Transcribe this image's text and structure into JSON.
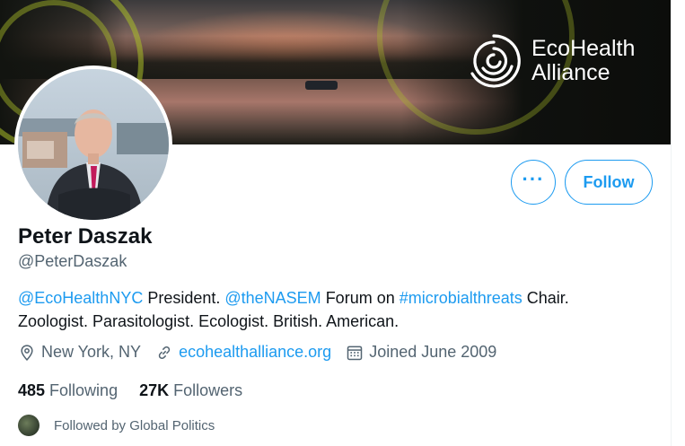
{
  "banner": {
    "brand_line1": "EcoHealth",
    "brand_line2": "Alliance",
    "logo_icon": "ecohealth-swirl-icon"
  },
  "profile": {
    "name": "Peter Daszak",
    "handle": "@PeterDaszak",
    "bio": {
      "mention1": "@EcoHealthNYC",
      "text1": " President. ",
      "mention2": "@theNASEM",
      "text2": " Forum on ",
      "hashtag": "#microbialthreats",
      "text3": " Chair.",
      "line2": "Zoologist. Parasitologist. Ecologist. British. American."
    },
    "location": "New York, NY",
    "website": "ecohealthalliance.org",
    "joined": "Joined June 2009",
    "following_count": "485",
    "following_label": "Following",
    "followers_count": "27K",
    "followers_label": "Followers",
    "followed_by": "Followed by Global Politics"
  },
  "actions": {
    "more_label": "···",
    "follow_label": "Follow"
  },
  "colors": {
    "accent": "#1d9bf0",
    "text_primary": "#0f1419",
    "text_secondary": "#536471"
  }
}
